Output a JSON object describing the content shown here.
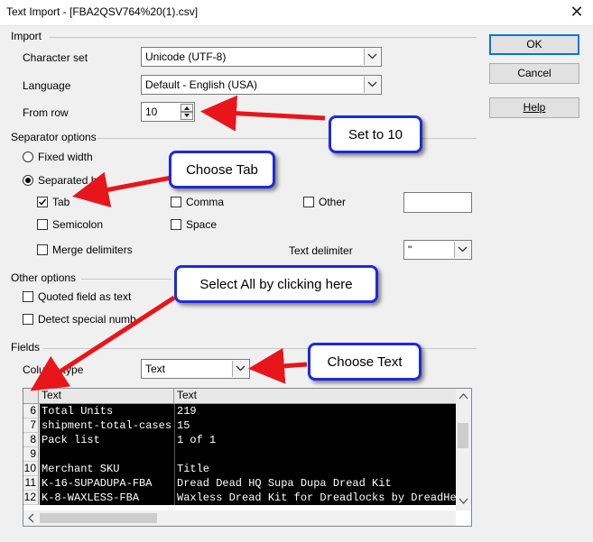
{
  "window": {
    "title": "Text Import - [FBA2QSV764%20(1).csv]",
    "close_glyph": "✕"
  },
  "buttons": {
    "ok": "OK",
    "cancel": "Cancel",
    "help": "Help"
  },
  "import": {
    "section": "Import",
    "charset_label": "Character set",
    "charset_value": "Unicode (UTF-8)",
    "language_label": "Language",
    "language_value": "Default - English (USA)",
    "from_row_label": "From row",
    "from_row_value": "10"
  },
  "separator": {
    "section": "Separator options",
    "fixed_width": "Fixed width",
    "separated_by": "Separated by",
    "tab": "Tab",
    "comma": "Comma",
    "other": "Other",
    "semicolon": "Semicolon",
    "space": "Space",
    "merge": "Merge delimiters",
    "text_delim_label": "Text delimiter",
    "text_delim_value": "\"",
    "tab_checked": true,
    "separated_selected": true
  },
  "other_options": {
    "section": "Other options",
    "quoted": "Quoted field as text",
    "detect": "Detect special numb"
  },
  "fields": {
    "section": "Fields",
    "column_type_label": "Column type",
    "column_type_value": "Text",
    "header": [
      "Text",
      "Text"
    ],
    "rows": [
      {
        "num": "6",
        "c1": "Total Units",
        "c2": "219",
        "selected": true
      },
      {
        "num": "7",
        "c1": "shipment-total-cases",
        "c2": "15",
        "selected": true
      },
      {
        "num": "8",
        "c1": "Pack list",
        "c2": "1 of 1",
        "selected": true
      },
      {
        "num": "9",
        "c1": "",
        "c2": "",
        "selected": true
      },
      {
        "num": "10",
        "c1": "Merchant SKU",
        "c2": "Title",
        "selected": true
      },
      {
        "num": "11",
        "c1": "K-16-SUPADUPA-FBA",
        "c2": "Dread Dead HQ Supa Dupa Dread Kit",
        "selected": true
      },
      {
        "num": "12",
        "c1": "K-8-WAXLESS-FBA",
        "c2": "Waxless Dread Kit for Dreadlocks by DreadHead",
        "selected": true
      }
    ]
  },
  "callouts": {
    "set_to_10": "Set to 10",
    "choose_tab": "Choose Tab",
    "select_all": "Select All by clicking here",
    "choose_text": "Choose Text"
  },
  "colors": {
    "arrow": "#e8151b",
    "callout_border": "#1d2bd8",
    "selection": "#000000"
  }
}
